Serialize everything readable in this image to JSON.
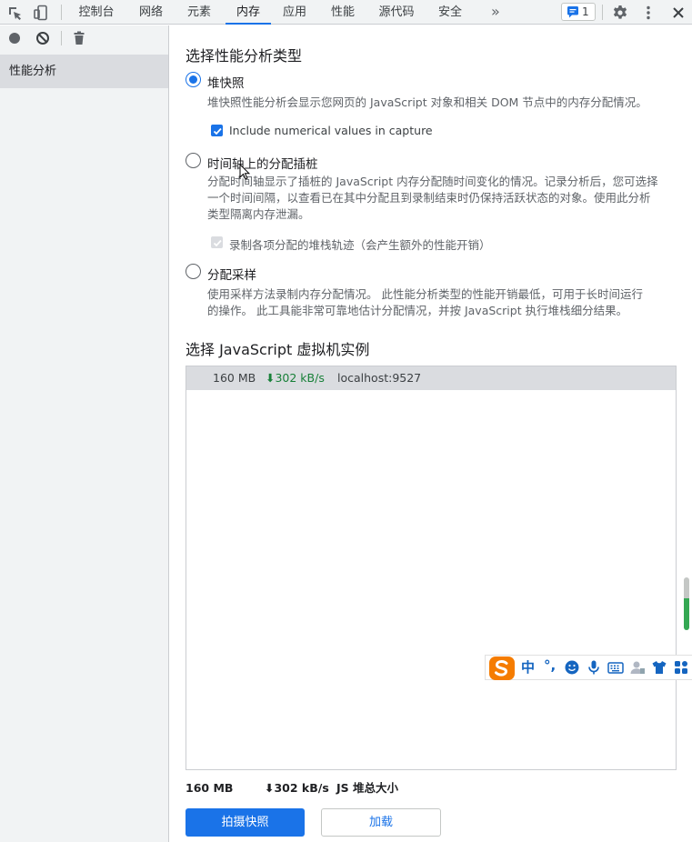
{
  "toolbar": {
    "tabs": [
      "控制台",
      "网络",
      "元素",
      "内存",
      "应用",
      "性能",
      "源代码",
      "安全"
    ],
    "active_tab": "内存",
    "issues_count": "1"
  },
  "sidebar": {
    "item": "性能分析"
  },
  "profile_type": {
    "heading": "选择性能分析类型",
    "options": [
      {
        "label": "堆快照",
        "selected": true,
        "description": "堆快照性能分析会显示您网页的 JavaScript 对象和相关 DOM 节点中的内存分配情况。",
        "checkbox_label": "Include numerical values in capture",
        "checkbox_checked": true
      },
      {
        "label": "时间轴上的分配插桩",
        "selected": false,
        "description_lines": [
          "分配时间轴显示了插桩的 JavaScript 内存分配随时间变化的情况。记录分析后，您可选择",
          "一个时间间隔，以查看已在其中分配且到录制结束时仍保持活跃状态的对象。使用此分析",
          "类型隔离内存泄漏。"
        ],
        "checkbox_label": "录制各项分配的堆栈轨迹（会产生额外的性能开销）",
        "checkbox_checked": true,
        "checkbox_disabled": true
      },
      {
        "label": "分配采样",
        "selected": false,
        "description_lines": [
          "使用采样方法录制内存分配情况。 此性能分析类型的性能开销最低，可用于长时间运行",
          "的操作。 此工具能非常可靠地估计分配情况，并按 JavaScript 执行堆栈细分结果。"
        ]
      }
    ]
  },
  "vm": {
    "heading": "选择 JavaScript 虚拟机实例",
    "rows": [
      {
        "size": "160 MB",
        "rate": "⬇302 kB/s",
        "target": "localhost:9527"
      }
    ]
  },
  "stats": {
    "size": "160 MB",
    "rate": "⬇302 kB/s",
    "label": "JS 堆总大小"
  },
  "actions": {
    "primary": "拍摄快照",
    "secondary": "加载"
  },
  "ime": {
    "lang": "中",
    "punct": "°,"
  },
  "colors": {
    "accent": "#1a73e8",
    "rate_green": "#188038",
    "ime_orange": "#f57c00",
    "ime_blue": "#1565c0"
  }
}
